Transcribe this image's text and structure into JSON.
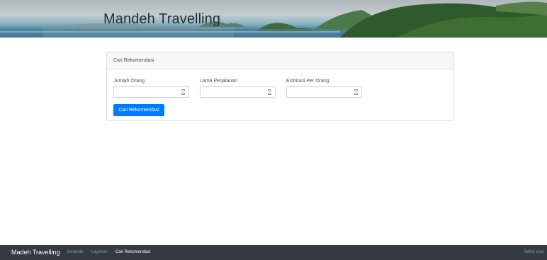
{
  "banner": {
    "title": "Mandeh Travelling"
  },
  "card": {
    "header": "Cari Rekomendasi",
    "fields": [
      {
        "label": "Jumlah Orang",
        "value": "",
        "placeholder": ""
      },
      {
        "label": "Lama Perjalanan",
        "value": "",
        "placeholder": ""
      },
      {
        "label": "Estimasi Per Orang",
        "value": "",
        "placeholder": ""
      }
    ],
    "submit_label": "Cari Rekomendasi"
  },
  "footer": {
    "brand": "Madeh Travelling",
    "nav": [
      {
        "label": "Beranda",
        "active": false
      },
      {
        "label": "Layanan",
        "active": false
      },
      {
        "label": "Cari Rekomendasi",
        "active": true
      }
    ],
    "user": "fadhli wavi"
  },
  "colors": {
    "primary": "#007bff",
    "footer_bg": "#343a40",
    "banner_water": "#4f87a0",
    "banner_hills": "#2f5a2b"
  }
}
